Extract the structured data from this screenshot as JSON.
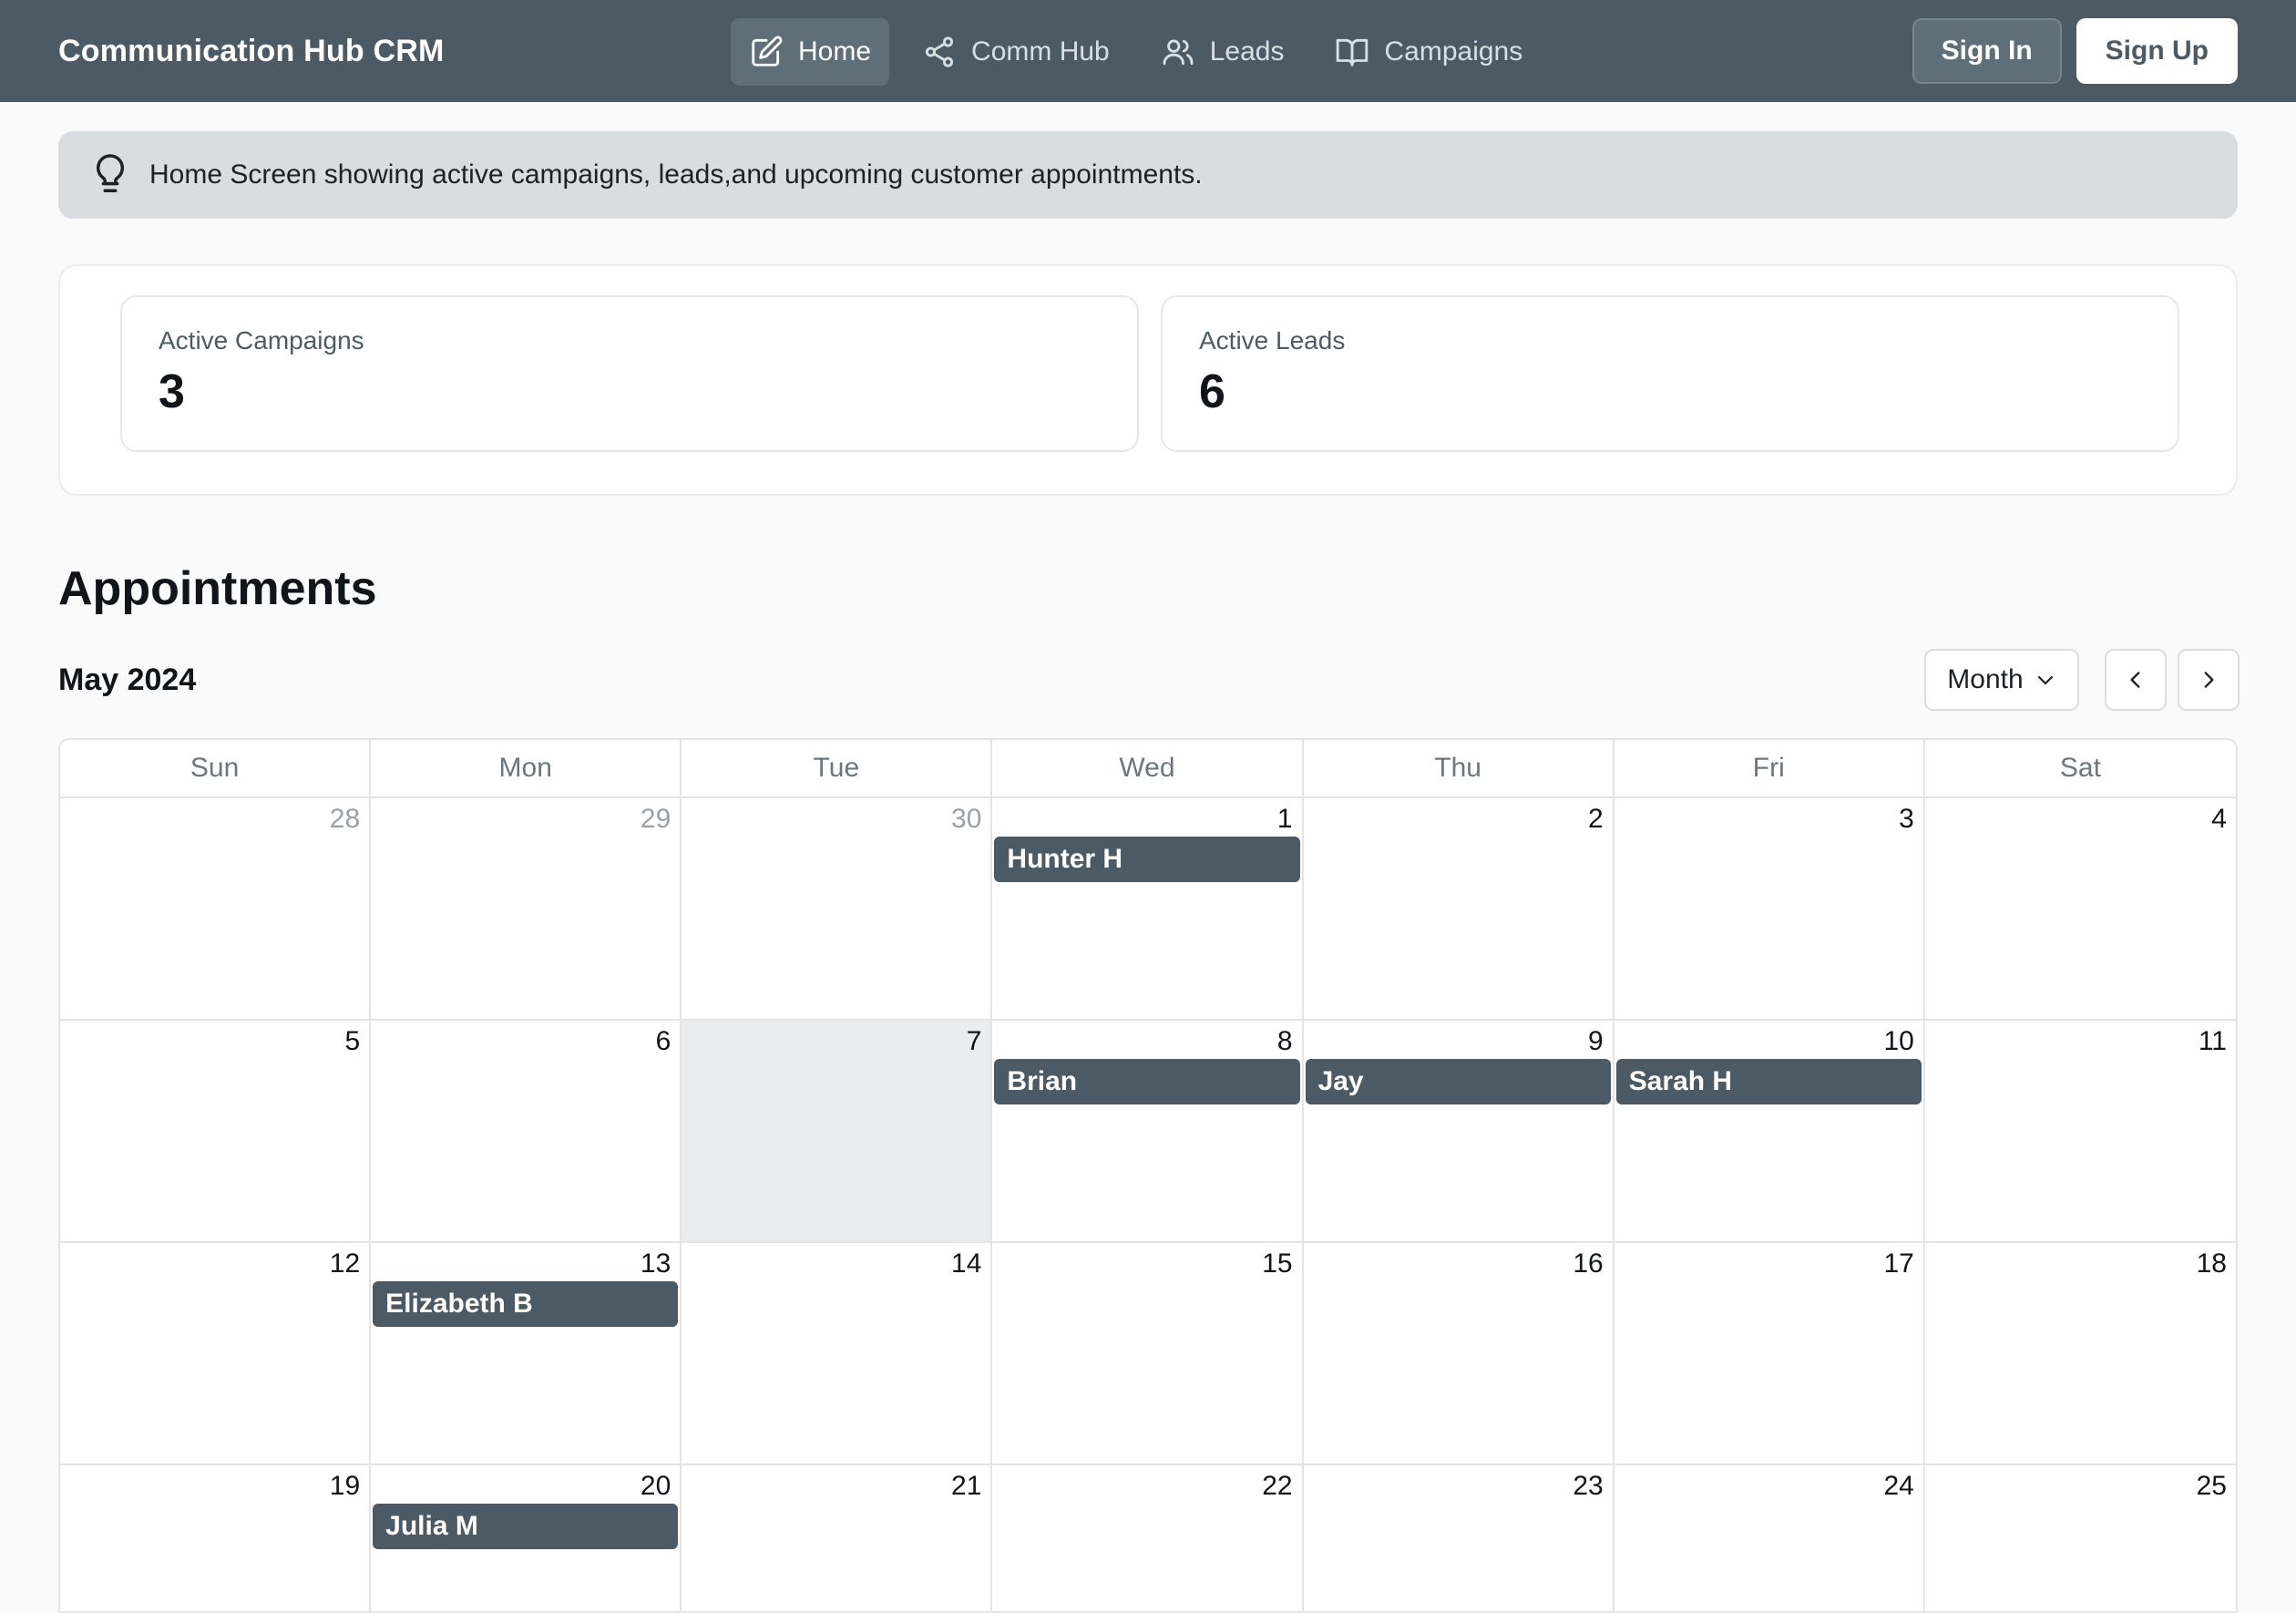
{
  "app": {
    "title": "Communication Hub CRM"
  },
  "nav": {
    "items": [
      {
        "label": "Home",
        "icon": "edit-square-icon",
        "active": true
      },
      {
        "label": "Comm Hub",
        "icon": "share-nodes-icon",
        "active": false
      },
      {
        "label": "Leads",
        "icon": "users-icon",
        "active": false
      },
      {
        "label": "Campaigns",
        "icon": "open-book-icon",
        "active": false
      }
    ],
    "sign_in": "Sign In",
    "sign_up": "Sign Up"
  },
  "alert": {
    "icon": "lightbulb-icon",
    "text": "Home Screen showing active campaigns, leads,and upcoming customer appointments."
  },
  "stats": [
    {
      "label": "Active Campaigns",
      "value": "3"
    },
    {
      "label": "Active Leads",
      "value": "6"
    }
  ],
  "appointments": {
    "title": "Appointments",
    "month": "May 2024",
    "view": "Month",
    "weekdays": [
      "Sun",
      "Mon",
      "Tue",
      "Wed",
      "Thu",
      "Fri",
      "Sat"
    ],
    "days": [
      {
        "num": "28",
        "other": true
      },
      {
        "num": "29",
        "other": true
      },
      {
        "num": "30",
        "other": true
      },
      {
        "num": "1",
        "event": "Hunter H"
      },
      {
        "num": "2"
      },
      {
        "num": "3"
      },
      {
        "num": "4"
      },
      {
        "num": "5"
      },
      {
        "num": "6"
      },
      {
        "num": "7",
        "today": true
      },
      {
        "num": "8",
        "event": "Brian"
      },
      {
        "num": "9",
        "event": "Jay"
      },
      {
        "num": "10",
        "event": "Sarah H"
      },
      {
        "num": "11"
      },
      {
        "num": "12"
      },
      {
        "num": "13",
        "event": "Elizabeth B"
      },
      {
        "num": "14"
      },
      {
        "num": "15"
      },
      {
        "num": "16"
      },
      {
        "num": "17"
      },
      {
        "num": "18"
      },
      {
        "num": "19"
      },
      {
        "num": "20",
        "event": "Julia M"
      },
      {
        "num": "21"
      },
      {
        "num": "22"
      },
      {
        "num": "23"
      },
      {
        "num": "24"
      },
      {
        "num": "25"
      }
    ]
  },
  "colors": {
    "nav_bg": "#4b5a64",
    "event_bg": "#4b5a64",
    "alert_bg": "#d9dde0",
    "today_bg": "#ebecee"
  }
}
